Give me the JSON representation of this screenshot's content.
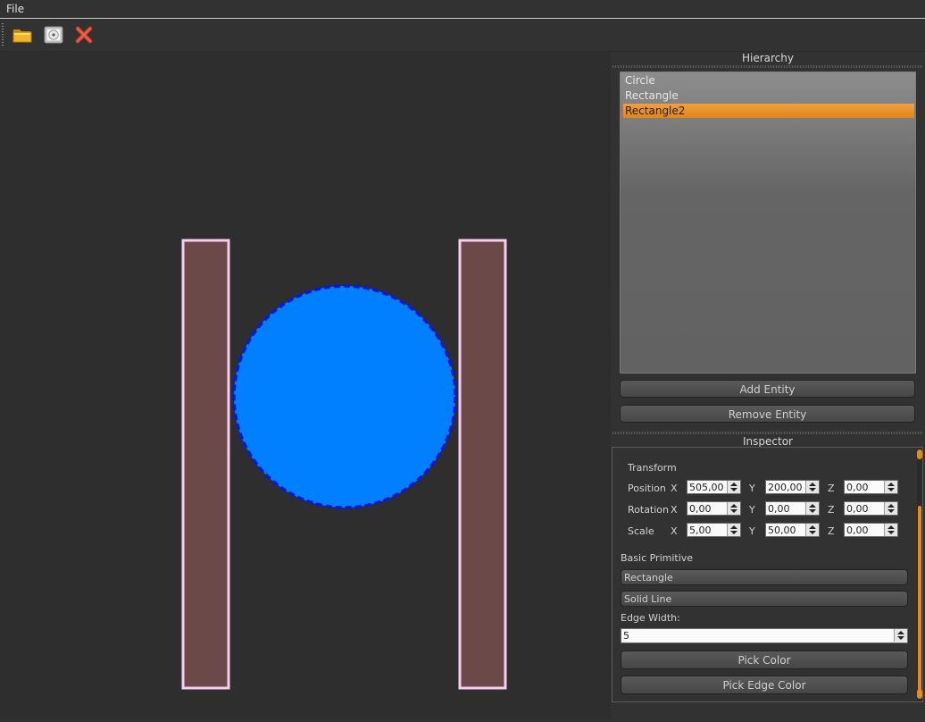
{
  "menu": {
    "file": "File"
  },
  "toolbar": [
    {
      "name": "open-folder-icon"
    },
    {
      "name": "save-disk-icon"
    },
    {
      "name": "close-x-icon"
    }
  ],
  "scene": {
    "colors": {
      "rect_fill": "#6a4948",
      "rect_edge": "#f7cdf0",
      "circle_fill": "#0080ff",
      "circle_edge": "#0a16e0"
    },
    "circle_edge_style": "dashed",
    "rect_edge_style": "solid"
  },
  "hierarchy": {
    "title": "Hierarchy",
    "items": [
      "Circle",
      "Rectangle",
      "Rectangle2"
    ],
    "selected": "Rectangle2",
    "add_button": "Add Entity",
    "remove_button": "Remove Entity"
  },
  "inspector": {
    "title": "Inspector",
    "transform_label": "Transform",
    "rows": [
      {
        "label": "Position",
        "x": "505,00",
        "y": "200,00",
        "z": "0,00"
      },
      {
        "label": "Rotation",
        "x": "0,00",
        "y": "0,00",
        "z": "0,00"
      },
      {
        "label": "Scale",
        "x": "5,00",
        "y": "50,00",
        "z": "0,00"
      }
    ],
    "axis": {
      "x": "X",
      "y": "Y",
      "z": "Z"
    },
    "basic_primitive_label": "Basic Primitive",
    "primitive_value": "Rectangle",
    "line_style_value": "Solid Line",
    "edge_width_label": "Edge Width:",
    "edge_width_value": "5",
    "pick_color_button": "Pick Color",
    "pick_edge_color_button": "Pick Edge Color",
    "accent": "#e78a1e"
  }
}
